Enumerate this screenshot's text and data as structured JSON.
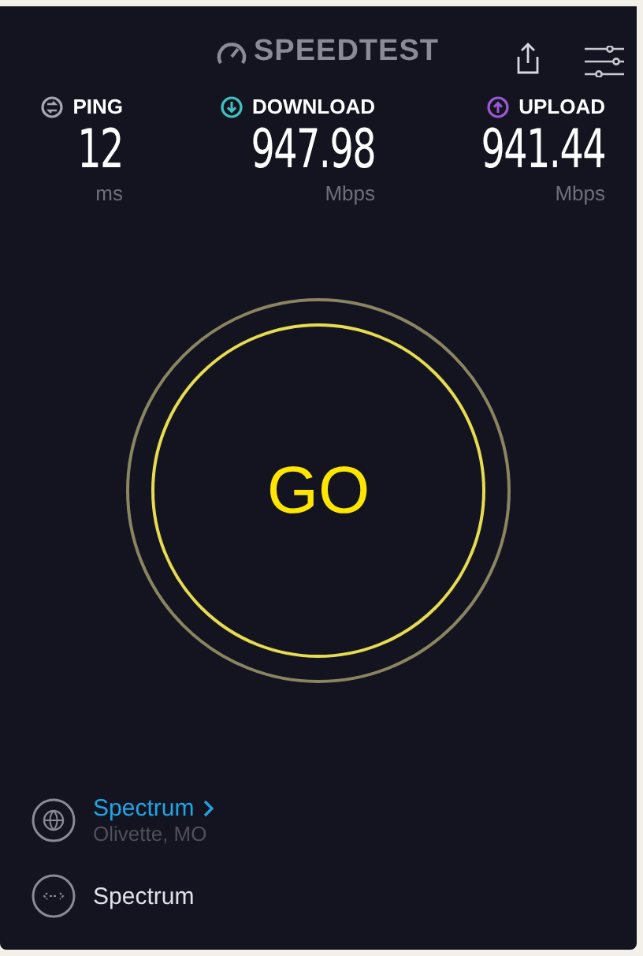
{
  "header": {
    "logo": "SPEEDTEST"
  },
  "metrics": [
    {
      "kind": "ping",
      "label": "PING",
      "value": "12",
      "unit": "ms",
      "color": "#a6a6b0"
    },
    {
      "kind": "download",
      "label": "DOWNLOAD",
      "value": "947.98",
      "unit": "Mbps",
      "color": "#3fc1c0"
    },
    {
      "kind": "upload",
      "label": "UPLOAD",
      "value": "941.44",
      "unit": "Mbps",
      "color": "#9b59d0"
    }
  ],
  "go_button": {
    "label": "GO"
  },
  "server": {
    "name": "Spectrum",
    "location": "Olivette, MO"
  },
  "provider": {
    "name": "Spectrum"
  }
}
